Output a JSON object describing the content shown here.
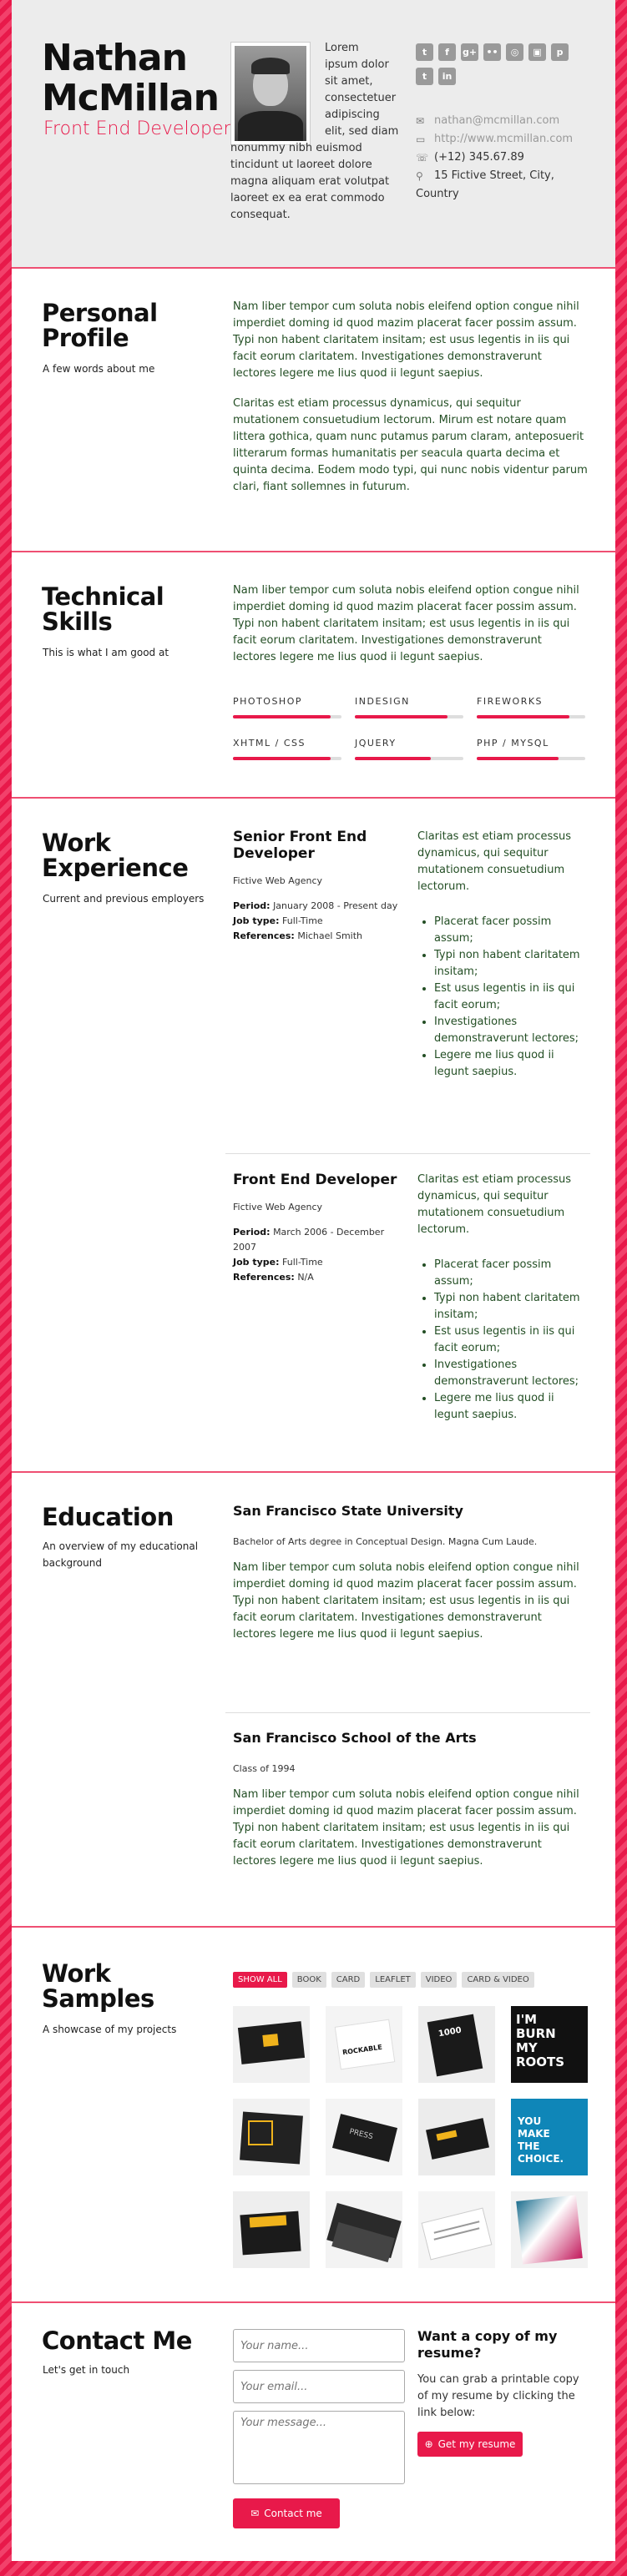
{
  "header": {
    "name_line1": "Nathan",
    "name_line2": "McMillan",
    "role": "Front End Developer",
    "bio_side": [
      "Lorem",
      "ipsum dolor",
      "sit amet,",
      "consectetuer",
      "adipiscing",
      "elit, sed diam"
    ],
    "bio_full": [
      "nonummy nibh euismod",
      "tincidunt ut laoreet dolore",
      "magna aliquam erat volutpat",
      "laoreet ex ea erat commodo",
      "consequat."
    ],
    "social": [
      {
        "icon": "twitter-icon",
        "glyph": "t"
      },
      {
        "icon": "facebook-icon",
        "glyph": "f"
      },
      {
        "icon": "google-plus-icon",
        "glyph": "g+"
      },
      {
        "icon": "flickr-icon",
        "glyph": "••"
      },
      {
        "icon": "dribbble-icon",
        "glyph": "◎"
      },
      {
        "icon": "instagram-icon",
        "glyph": "▣"
      },
      {
        "icon": "pinterest-icon",
        "glyph": "p"
      },
      {
        "icon": "tumblr-icon",
        "glyph": "t"
      },
      {
        "icon": "linkedin-icon",
        "glyph": "in"
      }
    ],
    "email": "nathan@mcmillan.com",
    "website": "http://www.mcmillan.com",
    "phone": "(+12) 345.67.89",
    "address": "15 Fictive Street, City,",
    "address2": "Country"
  },
  "profile": {
    "title_line1": "Personal",
    "title_line2": "Profile",
    "subtitle": "A few words about me",
    "p1": "Nam liber tempor cum soluta nobis eleifend option congue nihil imperdiet doming id quod mazim placerat facer possim assum. Typi non habent claritatem insitam; est usus legentis in iis qui facit eorum claritatem. Investigationes demonstraverunt lectores legere me lius quod ii legunt saepius.",
    "p2": "Claritas est etiam processus dynamicus, qui sequitur mutationem consuetudium lectorum. Mirum est notare quam littera gothica, quam nunc putamus parum claram, anteposuerit litterarum formas humanitatis per seacula quarta decima et quinta decima. Eodem modo typi, qui nunc nobis videntur parum clari, fiant sollemnes in futurum."
  },
  "skills": {
    "title_line1": "Technical",
    "title_line2": "Skills",
    "subtitle": "This is what I am good at",
    "p1": "Nam liber tempor cum soluta nobis eleifend option congue nihil imperdiet doming id quod mazim placerat facer possim assum. Typi non habent claritatem insitam; est usus legentis in iis qui facit eorum claritatem. Investigationes demonstraverunt lectores legere me lius quod ii legunt saepius.",
    "items": [
      {
        "label": "PHOTOSHOP",
        "level": 0.9
      },
      {
        "label": "INDESIGN",
        "level": 0.85
      },
      {
        "label": "FIREWORKS",
        "level": 0.85
      },
      {
        "label": "XHTML / CSS",
        "level": 0.9
      },
      {
        "label": "JQUERY",
        "level": 0.7
      },
      {
        "label": "PHP / MYSQL",
        "level": 0.75
      }
    ]
  },
  "work": {
    "title_line1": "Work",
    "title_line2": "Experience",
    "subtitle": "Current and previous employers",
    "jobs": [
      {
        "title_line1": "Senior Front End",
        "title_line2": "Developer",
        "company": "Fictive Web Agency",
        "period_label": "Period:",
        "period": "January 2008 - Present day",
        "type_label": "Job type:",
        "type": "Full-Time",
        "ref_label": "References:",
        "ref": "Michael Smith",
        "desc": "Claritas est etiam processus dynamicus, qui sequitur mutationem consuetudium lectorum.",
        "bullets": [
          "Placerat facer possim assum;",
          "Typi non habent claritatem insitam;",
          "Est usus legentis in iis qui facit eorum;",
          "Investigationes demonstraverunt lectores;",
          "Legere me lius quod ii legunt saepius."
        ]
      },
      {
        "title_line1": "Front End Developer",
        "title_line2": "",
        "company": "Fictive Web Agency",
        "period_label": "Period:",
        "period": "March 2006 - December 2007",
        "type_label": "Job type:",
        "type": "Full-Time",
        "ref_label": "References:",
        "ref": "N/A",
        "desc": "Claritas est etiam processus dynamicus, qui sequitur mutationem consuetudium lectorum.",
        "bullets": [
          "Placerat facer possim assum;",
          "Typi non habent claritatem insitam;",
          "Est usus legentis in iis qui facit eorum;",
          "Investigationes demonstraverunt lectores;",
          "Legere me lius quod ii legunt saepius."
        ]
      }
    ]
  },
  "education": {
    "title": "Education",
    "subtitle": "An overview of my educational background",
    "schools": [
      {
        "name": "San Francisco State University",
        "degree": "Bachelor of Arts degree in Conceptual Design. Magna Cum Laude.",
        "text": "Nam liber tempor cum soluta nobis eleifend option congue nihil imperdiet doming id quod mazim placerat facer possim assum. Typi non habent claritatem insitam; est usus legentis in iis qui facit eorum claritatem. Investigationes demonstraverunt lectores legere me lius quod ii legunt saepius."
      },
      {
        "name": "San Francisco School of the Arts",
        "degree": "Class of 1994",
        "text": "Nam liber tempor cum soluta nobis eleifend option congue nihil imperdiet doming id quod mazim placerat facer possim assum. Typi non habent claritatem insitam; est usus legentis in iis qui facit eorum claritatem. Investigationes demonstraverunt lectores legere me lius quod ii legunt saepius."
      }
    ]
  },
  "samples": {
    "title_line1": "Work",
    "title_line2": "Samples",
    "subtitle": "A showcase of my projects",
    "filters": [
      "SHOW ALL",
      "BOOK",
      "CARD",
      "LEAFLET",
      "VIDEO",
      "CARD & VIDEO"
    ],
    "thumb_texts": {
      "im_burn": [
        "I'M",
        "BURN",
        "MY",
        "ROOTS"
      ],
      "make_choice": [
        "YOU",
        "MAKE",
        "THE CHOICE."
      ],
      "rockable": "ROCKABLE",
      "one": "1000",
      "press": "PRESS"
    }
  },
  "contact": {
    "title": "Contact Me",
    "subtitle": "Let's get in touch",
    "name_placeholder": "Your name...",
    "email_placeholder": "Your email...",
    "message_placeholder": "Your message...",
    "send_label": "Contact me",
    "copy_title_line1": "Want a copy of my",
    "copy_title_line2": "resume?",
    "copy_text": "You can grab a printable copy of my resume by clicking the link below:",
    "resume_label": "Get my resume"
  },
  "colors": {
    "accent": "#e8194a",
    "text_green": "#234e24",
    "header_bg": "#ececec"
  }
}
